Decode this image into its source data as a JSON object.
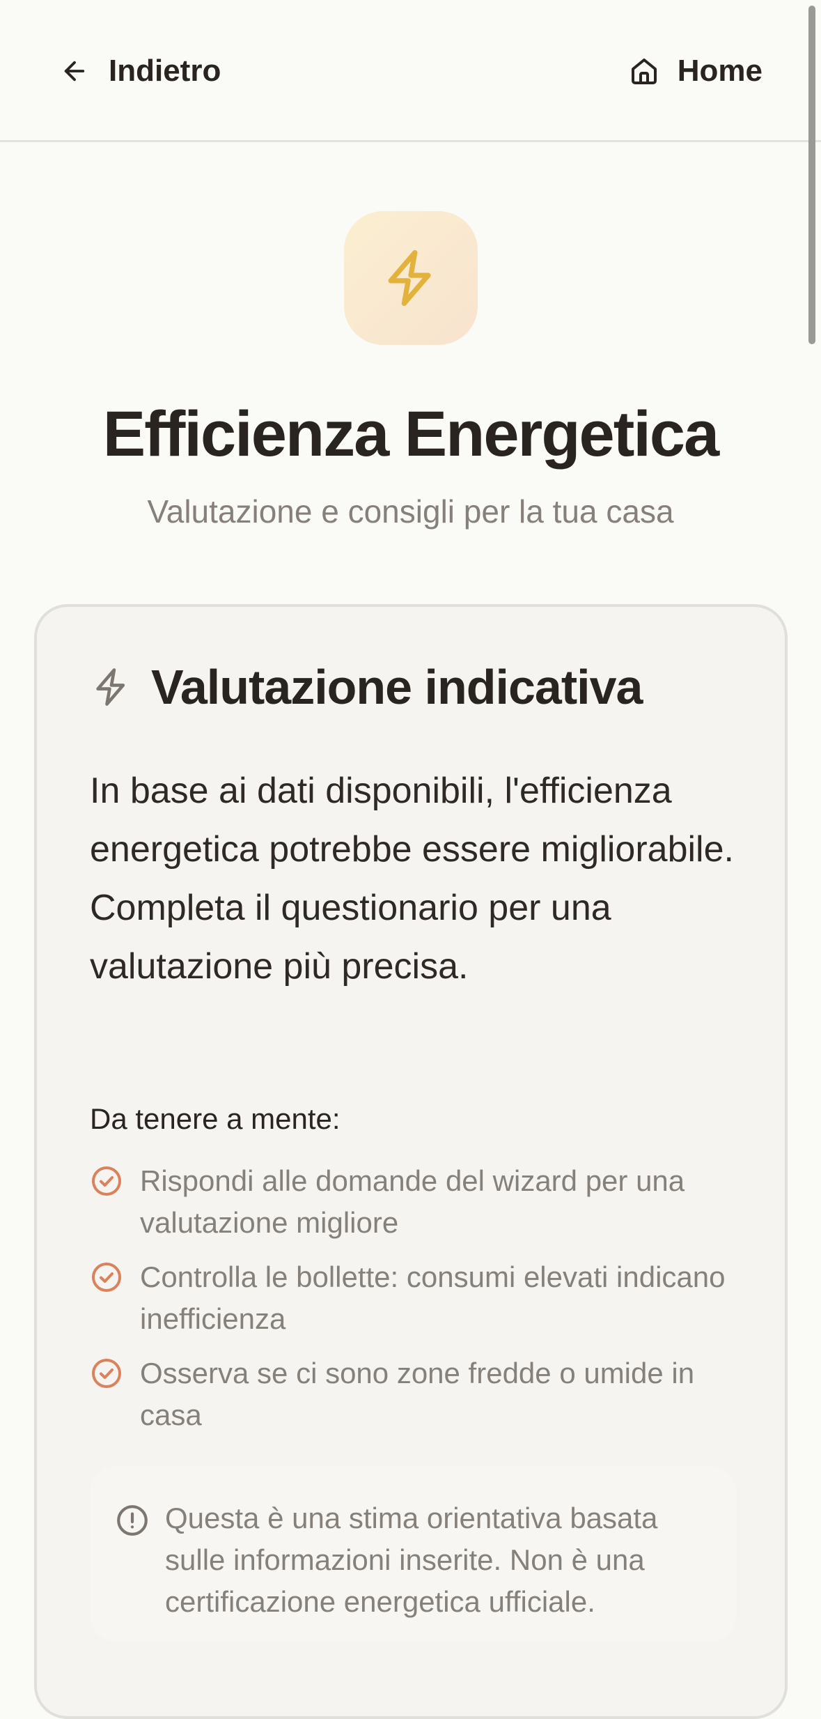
{
  "header": {
    "back_label": "Indietro",
    "home_label": "Home"
  },
  "hero": {
    "icon": "lightning-bolt-icon",
    "title": "Efficienza Energetica",
    "subtitle": "Valutazione e consigli per la tua casa"
  },
  "card": {
    "icon": "lightning-bolt-icon",
    "title": "Valutazione indicativa",
    "body": "In base ai dati disponibili, l'efficienza energetica potrebbe essere migliorabile. Completa il questionario per una valutazione più precisa.",
    "remember_title": "Da tenere a mente:",
    "tips": [
      "Rispondi alle domande del wizard per una valutazione migliore",
      "Controlla le bollette: consumi elevati indicano inefficienza",
      "Osserva se ci sono zone fredde o umide in casa"
    ],
    "note": "Questa è una stima orientativa basata sulle informazioni inserite. Non è una certificazione energetica ufficiale."
  },
  "colors": {
    "background": "#fafaf7",
    "accent_orange": "#d9825b",
    "bolt_yellow": "#e3b23c",
    "text_dark": "#2a2420",
    "text_muted": "#86807a"
  }
}
